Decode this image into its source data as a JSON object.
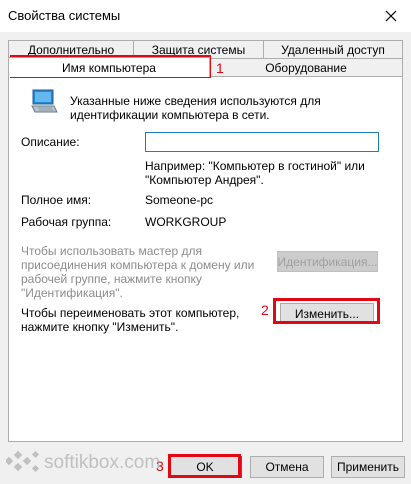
{
  "window": {
    "title": "Свойства системы"
  },
  "tabs": {
    "row1": [
      "Дополнительно",
      "Защита системы",
      "Удаленный доступ"
    ],
    "row2": [
      "Имя компьютера",
      "Оборудование"
    ]
  },
  "panel": {
    "info_line1": "Указанные ниже сведения используются для",
    "info_line2": "идентификации компьютера в сети.",
    "description_label": "Описание:",
    "description_value": "",
    "example_line1": "Например: \"Компьютер в гостиной\" или",
    "example_line2": "\"Компьютер Андрея\".",
    "fullname_label": "Полное имя:",
    "fullname_value": "Someone-pc",
    "workgroup_label": "Рабочая группа:",
    "workgroup_value": "WORKGROUP",
    "wizard_line1": "Чтобы использовать мастер для",
    "wizard_line2": "присоединения компьютера к домену или",
    "wizard_line3": "рабочей группе, нажмите кнопку",
    "wizard_line4": "\"Идентификация\".",
    "identify_button": "Идентификация...",
    "rename_line1": "Чтобы переименовать этот компьютер,",
    "rename_line2": "нажмите кнопку \"Изменить\".",
    "change_button": "Изменить..."
  },
  "footer": {
    "ok": "OK",
    "cancel": "Отмена",
    "apply": "Применить"
  },
  "annotations": [
    "1",
    "2",
    "3"
  ],
  "watermark": {
    "text": "softikbox.com"
  },
  "colors": {
    "highlight": "#e30613",
    "accent": "#0078d7"
  }
}
